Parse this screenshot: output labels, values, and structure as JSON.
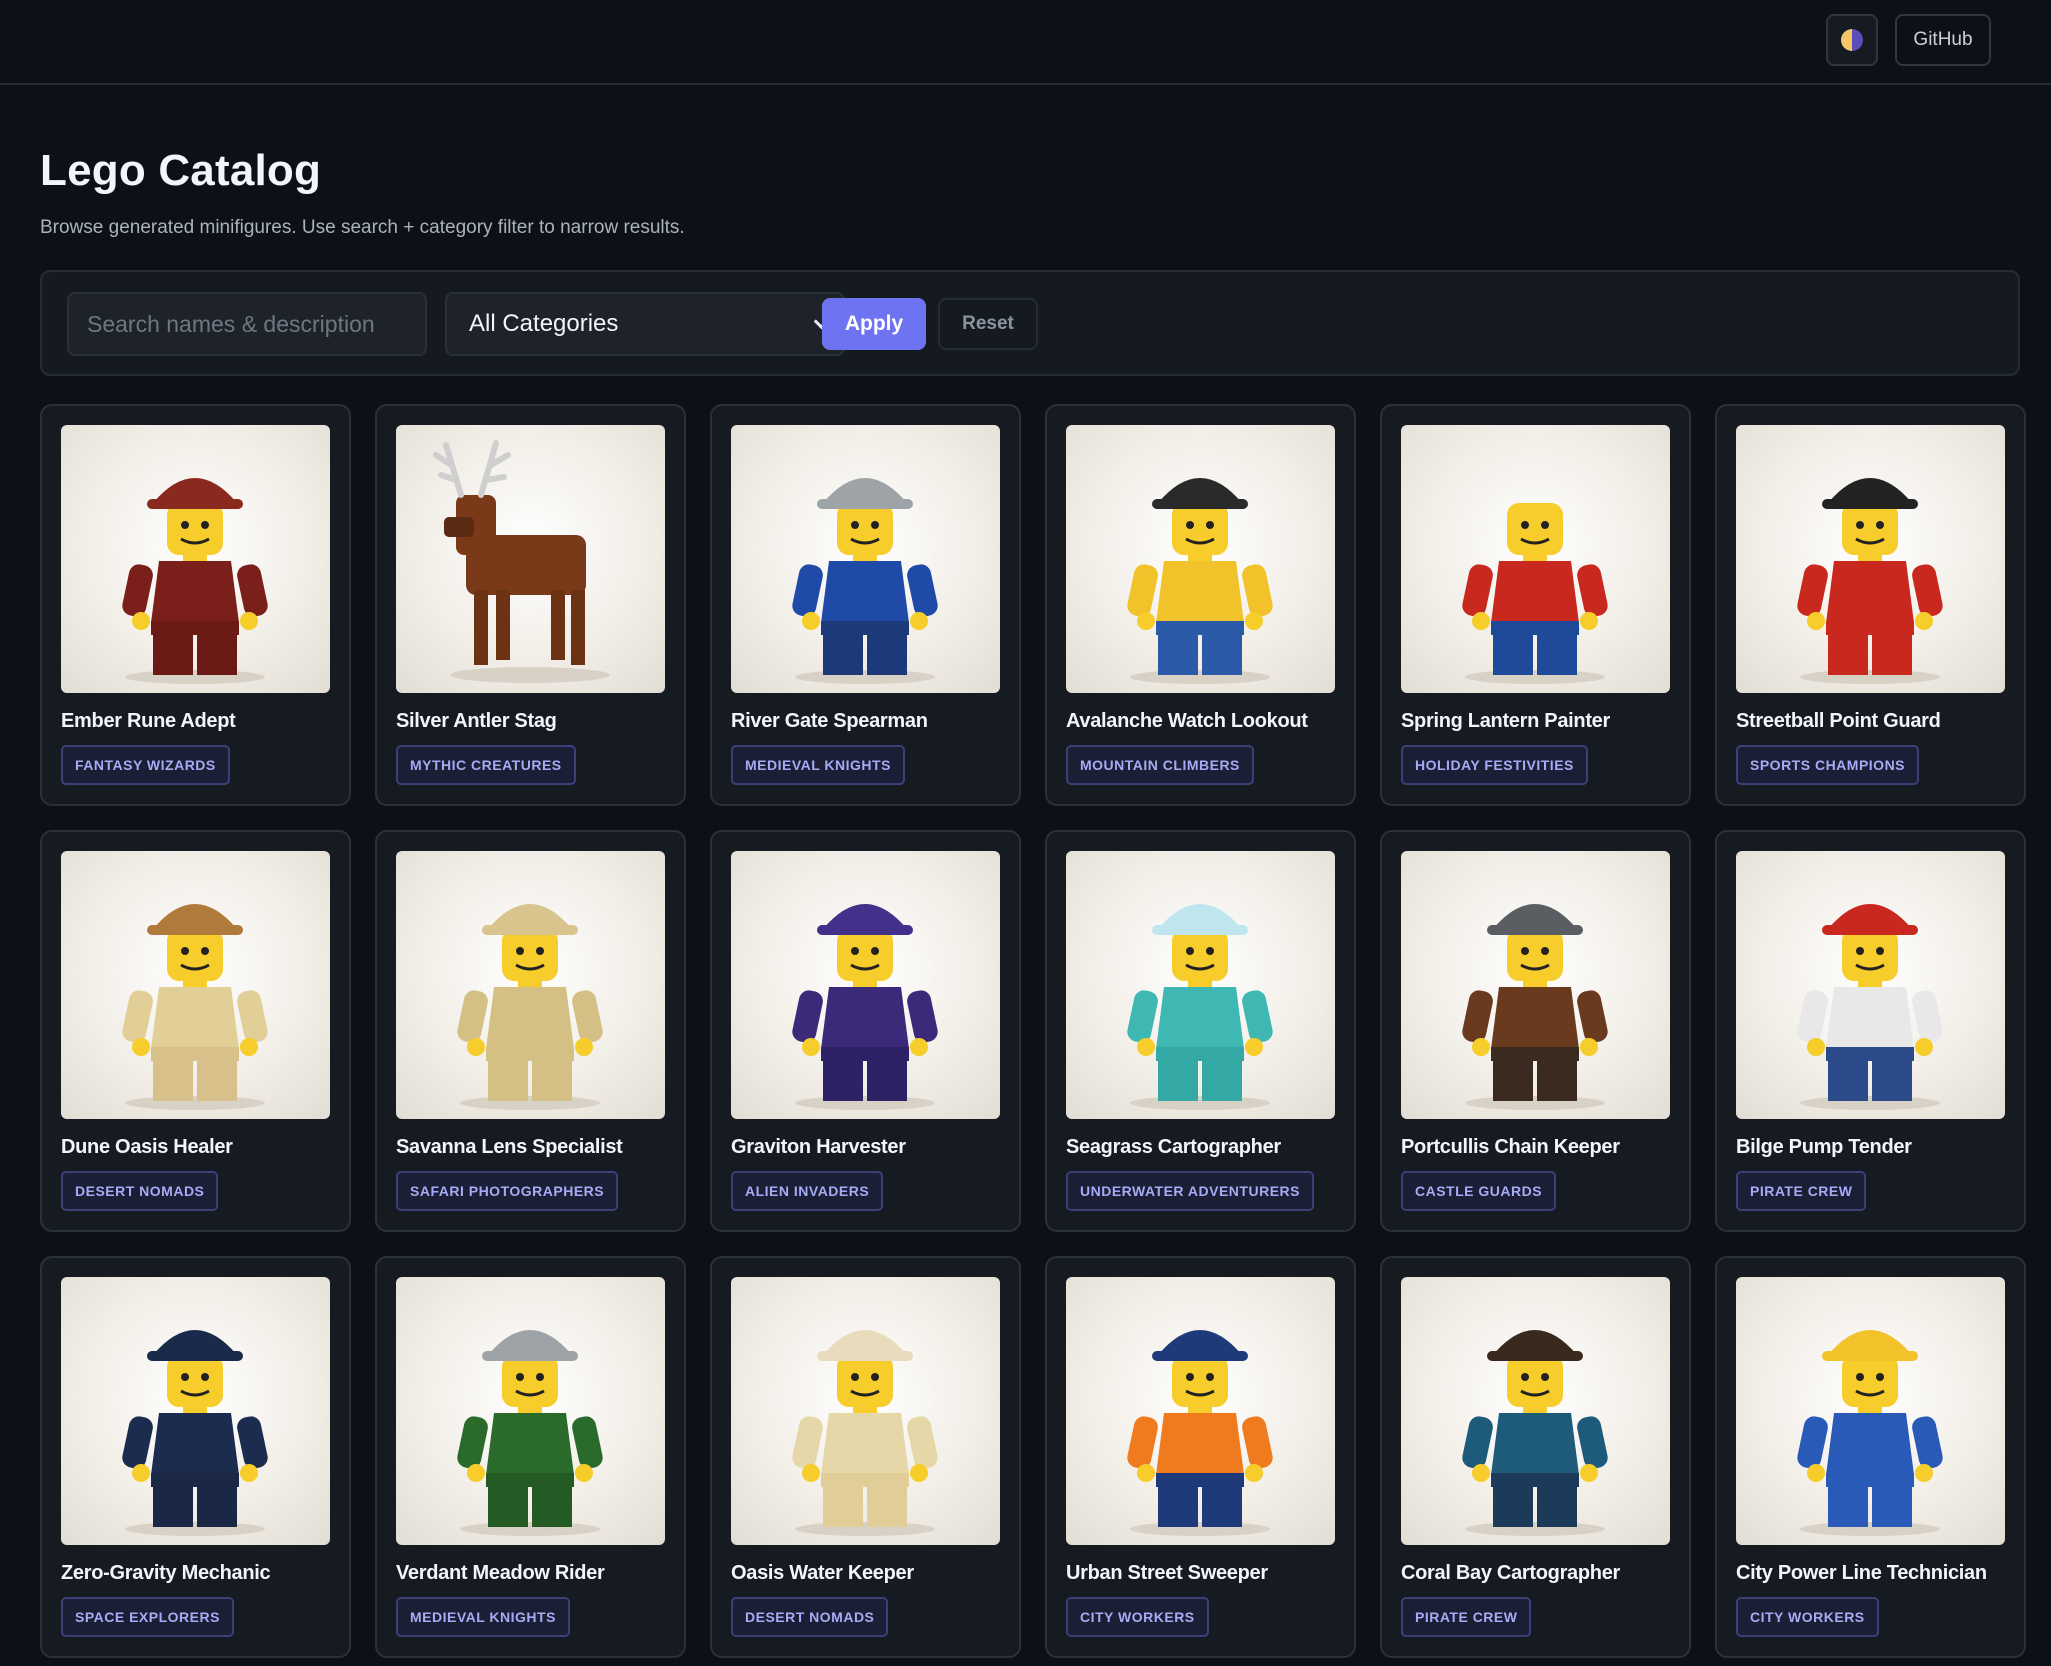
{
  "header": {
    "theme_toggle_icon": "half-moon-icon",
    "github_label": "GitHub"
  },
  "page": {
    "title": "Lego Catalog",
    "subtitle": "Browse generated minifigures. Use search + category filter to narrow results."
  },
  "filters": {
    "search_placeholder": "Search names & description",
    "search_value": "",
    "category_selected": "All Categories",
    "apply_label": "Apply",
    "reset_label": "Reset"
  },
  "colors": {
    "accent": "#6e73f2",
    "background": "#0d1117",
    "card": "#161b22",
    "badge_text": "#a6abf5"
  },
  "cards": [
    {
      "name": "Ember Rune Adept",
      "category": "FANTASY WIZARDS",
      "torso": "#7a1f1a",
      "legs": "#6b1a16",
      "hat": "#8a2a1e",
      "icon": "wizard-minifigure"
    },
    {
      "name": "Silver Antler Stag",
      "category": "MYTHIC CREATURES",
      "torso": "#7a3a1a",
      "legs": "#6b3214",
      "hat": "none",
      "icon": "stag-figure"
    },
    {
      "name": "River Gate Spearman",
      "category": "MEDIEVAL KNIGHTS",
      "torso": "#1f4aa8",
      "legs": "#1c3a7a",
      "hat": "#9ea3a8",
      "icon": "spearman-minifigure"
    },
    {
      "name": "Avalanche Watch Lookout",
      "category": "MOUNTAIN CLIMBERS",
      "torso": "#f2c22a",
      "legs": "#2a5aa8",
      "hat": "#2a2a2a",
      "icon": "lookout-minifigure"
    },
    {
      "name": "Spring Lantern Painter",
      "category": "HOLIDAY FESTIVITIES",
      "torso": "#c8281e",
      "legs": "#1f4a9a",
      "hat": "none",
      "icon": "painter-minifigure"
    },
    {
      "name": "Streetball Point Guard",
      "category": "SPORTS CHAMPIONS",
      "torso": "#c8281e",
      "legs": "#c8281e",
      "hat": "#222222",
      "icon": "basketball-minifigure"
    },
    {
      "name": "Dune Oasis Healer",
      "category": "DESERT NOMADS",
      "torso": "#e2cf98",
      "legs": "#d8c08a",
      "hat": "#b07a3a",
      "icon": "healer-minifigure"
    },
    {
      "name": "Savanna Lens Specialist",
      "category": "SAFARI PHOTOGRAPHERS",
      "torso": "#d4bf84",
      "legs": "#d4bf84",
      "hat": "#d8c48c",
      "icon": "photographer-minifigure"
    },
    {
      "name": "Graviton Harvester",
      "category": "ALIEN INVADERS",
      "torso": "#3b2a7a",
      "legs": "#2e2266",
      "hat": "#43308a",
      "icon": "alien-minifigure"
    },
    {
      "name": "Seagrass Cartographer",
      "category": "UNDERWATER ADVENTURERS",
      "torso": "#3fb8b4",
      "legs": "#34a8a4",
      "hat": "#bfe6ee",
      "icon": "diver-minifigure"
    },
    {
      "name": "Portcullis Chain Keeper",
      "category": "CASTLE GUARDS",
      "torso": "#6a3a1e",
      "legs": "#3a2a20",
      "hat": "#5a5e62",
      "icon": "guard-minifigure"
    },
    {
      "name": "Bilge Pump Tender",
      "category": "PIRATE CREW",
      "torso": "#e8e8e8",
      "legs": "#2a4a8a",
      "hat": "#c8281e",
      "icon": "pirate-minifigure"
    },
    {
      "name": "Zero-Gravity Mechanic",
      "category": "SPACE EXPLORERS",
      "torso": "#1c2c4e",
      "legs": "#1a2846",
      "hat": "#1a2a4a",
      "icon": "mechanic-minifigure"
    },
    {
      "name": "Verdant Meadow Rider",
      "category": "MEDIEVAL KNIGHTS",
      "torso": "#2a6a2a",
      "legs": "#245a24",
      "hat": "#9ea3a8",
      "icon": "knight-minifigure"
    },
    {
      "name": "Oasis Water Keeper",
      "category": "DESERT NOMADS",
      "torso": "#e6d7a8",
      "legs": "#e0cd98",
      "hat": "#e8dcbc",
      "icon": "water-keeper-minifigure"
    },
    {
      "name": "Urban Street Sweeper",
      "category": "CITY WORKERS",
      "torso": "#f07a1e",
      "legs": "#1f3a7a",
      "hat": "#1f3a7a",
      "icon": "sweeper-minifigure"
    },
    {
      "name": "Coral Bay Cartographer",
      "category": "PIRATE CREW",
      "torso": "#1e5a7a",
      "legs": "#1c3a5a",
      "hat": "#3a2a1e",
      "icon": "cartographer-minifigure"
    },
    {
      "name": "City Power Line Technician",
      "category": "CITY WORKERS",
      "torso": "#2a5ab8",
      "legs": "#2a5ab8",
      "hat": "#f2c22a",
      "icon": "technician-minifigure"
    }
  ]
}
